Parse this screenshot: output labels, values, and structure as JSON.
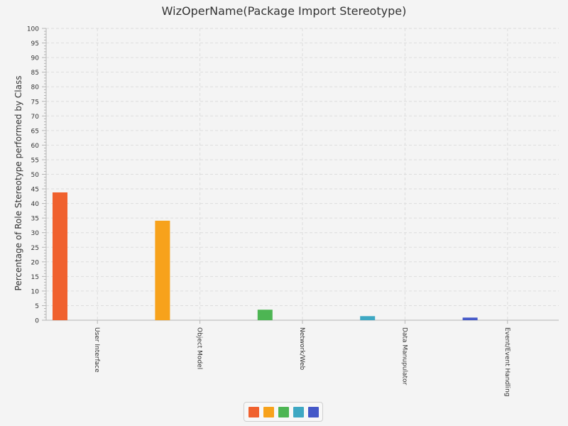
{
  "chart_data": {
    "type": "bar",
    "title": "WizOperName(Package Import Stereotype)",
    "xlabel": "",
    "ylabel": "Percentage of Role Stereotype performed by Class",
    "ylim": [
      0,
      100
    ],
    "ytick_step": 5,
    "yticks": [
      "0",
      "5",
      "10",
      "15",
      "20",
      "25",
      "30",
      "35",
      "40",
      "45",
      "50",
      "55",
      "60",
      "65",
      "70",
      "75",
      "80",
      "85",
      "90",
      "95",
      "100"
    ],
    "grid": true,
    "legend_position": "bottom",
    "categories": [
      "User Interface",
      "Object Model",
      "Network/Web",
      "Data Manupulator",
      "Event/Event Handling"
    ],
    "values": [
      43.8,
      34.1,
      3.6,
      1.4,
      0.9
    ],
    "colors": [
      "#f0612e",
      "#f7a21b",
      "#4db553",
      "#3ea8c3",
      "#4458c8"
    ]
  },
  "legend": {
    "swatches": [
      "#f0612e",
      "#f7a21b",
      "#4db553",
      "#3ea8c3",
      "#4458c8"
    ]
  }
}
